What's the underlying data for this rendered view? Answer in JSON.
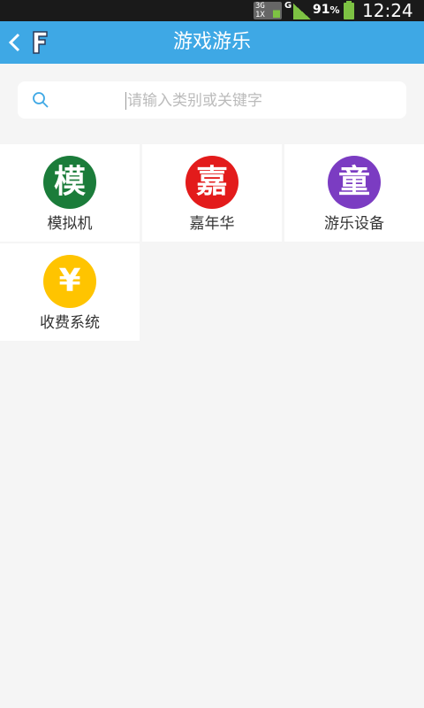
{
  "status_bar": {
    "network": "3G",
    "network_sub": "1X",
    "signal_type": "G",
    "battery_percent": "91",
    "percent_sign": "%",
    "time": "12:24"
  },
  "app_bar": {
    "title": "游戏游乐",
    "back_icon": "chevron-left-icon",
    "logo_icon": "f-logo-icon",
    "color": "#3ea8e5"
  },
  "search": {
    "placeholder": "请输入类别或关键字",
    "icon": "search-icon"
  },
  "categories": [
    {
      "label": "模拟机",
      "glyph": "模",
      "color": "#1b7c3a"
    },
    {
      "label": "嘉年华",
      "glyph": "嘉",
      "color": "#e31b1b"
    },
    {
      "label": "游乐设备",
      "glyph": "童",
      "color": "#7b3cc2"
    },
    {
      "label": "收费系统",
      "glyph": "¥",
      "color": "#ffc400"
    }
  ]
}
